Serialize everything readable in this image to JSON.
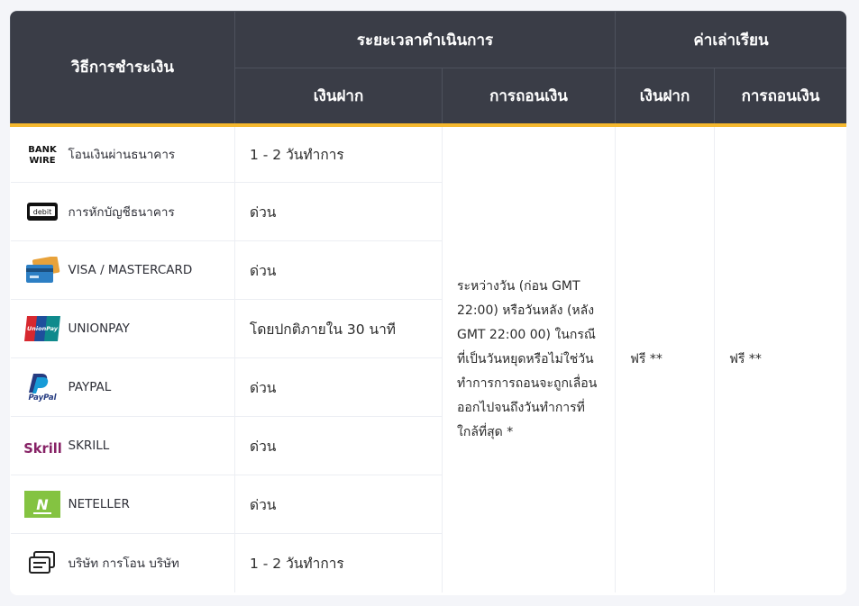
{
  "header": {
    "method": "วิธีการชำระเงิน",
    "processing_time": "ระยะเวลาดำเนินการ",
    "fees": "ค่าเล่าเรียน",
    "deposit": "เงินฝาก",
    "withdrawal": "การถอนเงิน",
    "fee_deposit": "เงินฝาก",
    "fee_withdrawal": "การถอนเงิน"
  },
  "rows": [
    {
      "icon": "bank-wire-icon",
      "label": "โอนเงินผ่านธนาคาร",
      "deposit": "1 - 2 วันทำการ"
    },
    {
      "icon": "debit-card-icon",
      "label": "การหักบัญชีธนาคาร",
      "deposit": "ด่วน"
    },
    {
      "icon": "credit-card-icon",
      "label": "VISA / MASTERCARD",
      "deposit": "ด่วน"
    },
    {
      "icon": "unionpay-icon",
      "label": "UNIONPAY",
      "deposit": "โดยปกติภายใน 30 นาที"
    },
    {
      "icon": "paypal-icon",
      "label": "PAYPAL",
      "deposit": "ด่วน"
    },
    {
      "icon": "skrill-icon",
      "label": "SKRILL",
      "deposit": "ด่วน"
    },
    {
      "icon": "neteller-icon",
      "label": "NETELLER",
      "deposit": "ด่วน"
    },
    {
      "icon": "company-transfer-icon",
      "label": "บริษัท การโอน บริษัท",
      "deposit": "1 - 2 วันทำการ"
    }
  ],
  "withdrawal_text": "ระหว่างวัน (ก่อน GMT 22:00) หรือวันหลัง (หลัง GMT 22:00 00) ในกรณีที่เป็นวันหยุดหรือไม่ใช่วันทำการการถอนจะถูกเลื่อนออกไปจนถึงวันทำการที่ใกล้ที่สุด *",
  "fee_deposit_value": "ฟรี **",
  "fee_withdrawal_value": "ฟรี **",
  "logos": {
    "bank_top": "BANK",
    "bank_bottom": "WIRE",
    "debit": "debit",
    "unionpay": "UnionPay",
    "paypal": "PayPal",
    "skrill": "Skrill",
    "neteller": "N"
  },
  "colors": {
    "header_bg": "#3a3d47",
    "accent": "#f5b82e"
  }
}
